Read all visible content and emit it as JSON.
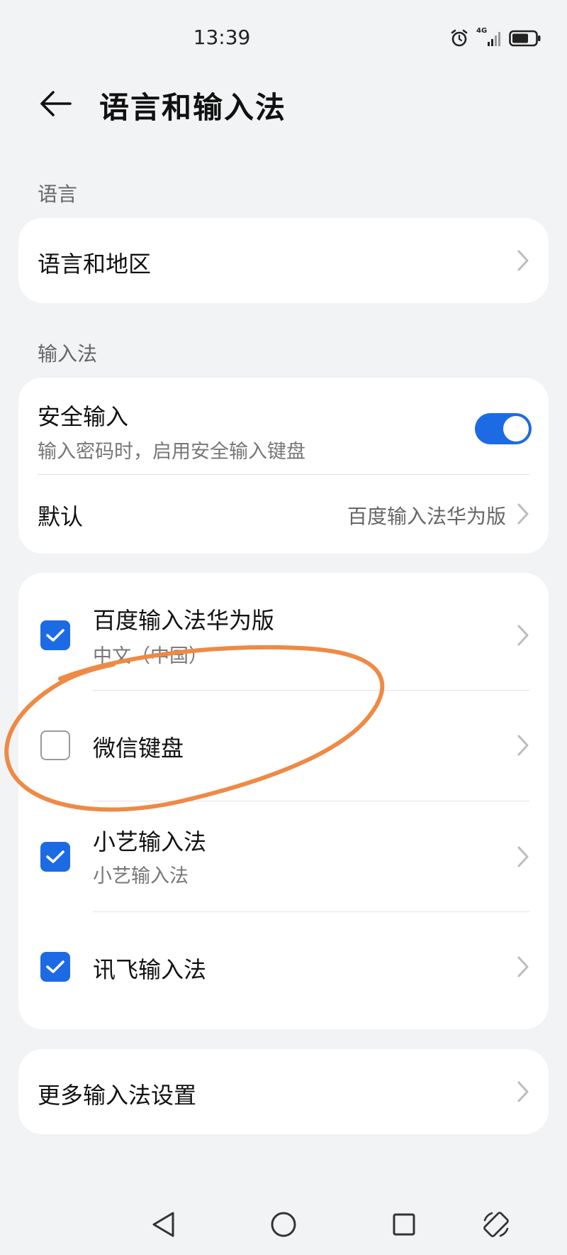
{
  "status_bar": {
    "time": "13:39",
    "network": "4G",
    "icons": [
      "alarm-icon",
      "signal-icon",
      "battery-icon"
    ]
  },
  "header": {
    "title": "语言和输入法",
    "back_icon": "arrow-left-icon"
  },
  "sections": {
    "language": {
      "header": "语言",
      "items": [
        {
          "title": "语言和地区"
        }
      ]
    },
    "input_method": {
      "header": "输入法",
      "secure_input": {
        "title": "安全输入",
        "subtitle": "输入密码时，启用安全输入键盘",
        "enabled": true
      },
      "default": {
        "title": "默认",
        "value": "百度输入法华为版"
      }
    }
  },
  "keyboards": [
    {
      "title": "百度输入法华为版",
      "subtitle": "中文（中国）",
      "checked": true
    },
    {
      "title": "微信键盘",
      "subtitle": "",
      "checked": false
    },
    {
      "title": "小艺输入法",
      "subtitle": "小艺输入法",
      "checked": true
    },
    {
      "title": "讯飞输入法",
      "subtitle": "",
      "checked": true
    }
  ],
  "more_settings": {
    "title": "更多输入法设置"
  },
  "colors": {
    "accent": "#1d6ae5",
    "annotation": "#ee8a45",
    "background": "#f1f3f5"
  },
  "nav_bar": {
    "icons": [
      "back-triangle-icon",
      "home-circle-icon",
      "recents-square-icon",
      "rotate-icon"
    ]
  }
}
